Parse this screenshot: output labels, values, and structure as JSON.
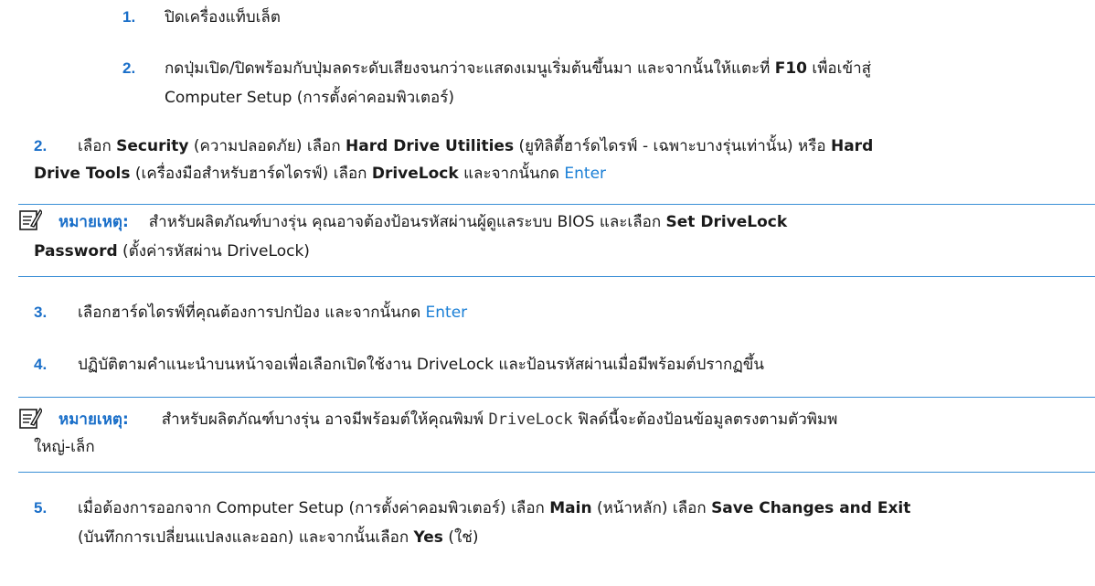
{
  "sub_steps": [
    {
      "number": "1.",
      "text": "ปิดเครื่องแท็บเล็ต"
    },
    {
      "number": "2.",
      "line1": "กดปุ่มเปิด/ปิดพร้อมกับปุ่มลดระดับเสียงจนกว่าจะแสดงเมนูเริ่มต้นขึ้นมา และจากนั้นให้แตะที่ ",
      "key": "F10",
      "line1_end": " เพื่อเข้าสู่",
      "line2": "Computer Setup (การตั้งค่าคอมพิวเตอร์)"
    }
  ],
  "step2": {
    "number": "2.",
    "t1": "เลือก ",
    "b1": "Security",
    "t2": " (ความปลอดภัย) เลือก ",
    "b2": "Hard Drive Utilities",
    "t3": " (ยูทิลิตี้ฮาร์ดไดรฟ์ - เฉพาะบางรุ่นเท่านั้น) หรือ ",
    "b3": "Hard",
    "b4": "Drive Tools",
    "t4": " (เครื่องมือสำหรับฮาร์ดไดรฟ์) เลือก ",
    "b5": "DriveLock",
    "t5": " และจากนั้นกด ",
    "link": "Enter"
  },
  "note1": {
    "icon": "note-icon",
    "label": "หมายเหตุ:",
    "t1": "สำหรับผลิตภัณฑ์บางรุ่น คุณอาจต้องป้อนรหัสผ่านผู้ดูแลระบบ BIOS และเลือก ",
    "b1": "Set DriveLock",
    "b2": "Password",
    "t2": " (ตั้งค่ารหัสผ่าน DriveLock)"
  },
  "step3": {
    "number": "3.",
    "text": "เลือกฮาร์ดไดรฟ์ที่คุณต้องการปกป้อง และจากนั้นกด ",
    "link": "Enter"
  },
  "step4": {
    "number": "4.",
    "text": "ปฏิบัติตามคำแนะนำบนหน้าจอเพื่อเลือกเปิดใช้งาน DriveLock และป้อนรหัสผ่านเมื่อมีพร้อมต์ปรากฏขึ้น"
  },
  "note2": {
    "icon": "note-icon",
    "label": "หมายเหตุ:",
    "t1": "สำหรับผลิตภัณฑ์บางรุ่น อาจมีพร้อมต์ให้คุณพิมพ์ ",
    "code": "DriveLock",
    "t2": " ฟิลด์นี้จะต้องป้อนข้อมูลตรงตามตัวพิมพ",
    "line2": "ใหญ่-เล็ก"
  },
  "step5": {
    "number": "5.",
    "t1": "เมื่อต้องการออกจาก Computer Setup (การตั้งค่าคอมพิวเตอร์) เลือก ",
    "b1": "Main",
    "t2": " (หน้าหลัก) เลือก ",
    "b2": "Save Changes and Exit",
    "t3": "(บันทึกการเปลี่ยนแปลงและออก) และจากนั้นเลือก ",
    "b3": "Yes",
    "t4": " (ใช่)"
  },
  "colors": {
    "accent": "#1a6fc9",
    "link": "#1a7fd6",
    "rule": "#3a8fd6"
  }
}
